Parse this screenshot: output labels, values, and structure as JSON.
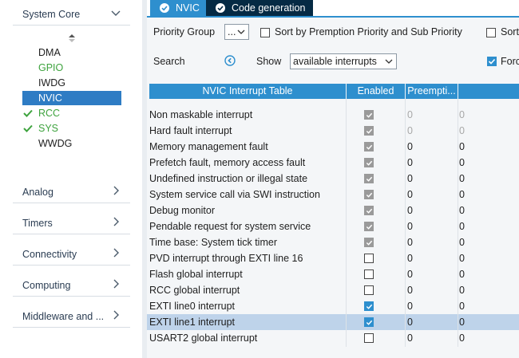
{
  "sidebar": {
    "categories": [
      {
        "label": "System Core",
        "expanded": true
      },
      {
        "label": "Analog"
      },
      {
        "label": "Timers"
      },
      {
        "label": "Connectivity"
      },
      {
        "label": "Computing"
      },
      {
        "label": "Middleware and ..."
      }
    ],
    "peripherals": [
      {
        "label": "DMA",
        "state": "normal"
      },
      {
        "label": "GPIO",
        "state": "green"
      },
      {
        "label": "IWDG",
        "state": "normal"
      },
      {
        "label": "NVIC",
        "state": "selected"
      },
      {
        "label": "RCC",
        "state": "green-checked"
      },
      {
        "label": "SYS",
        "state": "green-checked"
      },
      {
        "label": "WWDG",
        "state": "normal"
      }
    ]
  },
  "tabs": [
    {
      "label": "NVIC",
      "icon": "check-circle-icon"
    },
    {
      "label": "Code generation",
      "icon": "check-circle-icon"
    }
  ],
  "options": {
    "priority_group_label": "Priority Group",
    "priority_group_value": "...",
    "sort_label": "Sort by Premption Priority and Sub Priority",
    "sort_checked": false,
    "sort2_label": "Sort",
    "search_label": "Search",
    "show_label": "Show",
    "show_value": "available interrupts",
    "force_label": "Forc",
    "force_checked": true
  },
  "table": {
    "headers": [
      "NVIC Interrupt Table",
      "Enabled",
      "Preempti...",
      ""
    ],
    "rows": [
      {
        "name": "Non maskable interrupt",
        "enabled": "disabled-checked",
        "preemption": "0",
        "sub": "0",
        "greyed": true,
        "selected": false
      },
      {
        "name": "Hard fault interrupt",
        "enabled": "disabled-checked",
        "preemption": "0",
        "sub": "0",
        "greyed": true,
        "selected": false
      },
      {
        "name": "Memory management fault",
        "enabled": "disabled-checked",
        "preemption": "0",
        "sub": "0",
        "greyed": false,
        "selected": false
      },
      {
        "name": "Prefetch fault, memory access fault",
        "enabled": "disabled-checked",
        "preemption": "0",
        "sub": "0",
        "greyed": false,
        "selected": false
      },
      {
        "name": "Undefined instruction or illegal state",
        "enabled": "disabled-checked",
        "preemption": "0",
        "sub": "0",
        "greyed": false,
        "selected": false
      },
      {
        "name": "System service call via SWI instruction",
        "enabled": "disabled-checked",
        "preemption": "0",
        "sub": "0",
        "greyed": false,
        "selected": false
      },
      {
        "name": "Debug monitor",
        "enabled": "disabled-checked",
        "preemption": "0",
        "sub": "0",
        "greyed": false,
        "selected": false
      },
      {
        "name": "Pendable request for system service",
        "enabled": "disabled-checked",
        "preemption": "0",
        "sub": "0",
        "greyed": false,
        "selected": false
      },
      {
        "name": "Time base: System tick timer",
        "enabled": "disabled-checked",
        "preemption": "0",
        "sub": "0",
        "greyed": false,
        "selected": false
      },
      {
        "name": "PVD interrupt through EXTI line 16",
        "enabled": "unchecked",
        "preemption": "0",
        "sub": "0",
        "greyed": false,
        "selected": false
      },
      {
        "name": "Flash global interrupt",
        "enabled": "unchecked",
        "preemption": "0",
        "sub": "0",
        "greyed": false,
        "selected": false
      },
      {
        "name": "RCC global interrupt",
        "enabled": "unchecked",
        "preemption": "0",
        "sub": "0",
        "greyed": false,
        "selected": false
      },
      {
        "name": "EXTI line0 interrupt",
        "enabled": "checked",
        "preemption": "0",
        "sub": "0",
        "greyed": false,
        "selected": false
      },
      {
        "name": "EXTI line1 interrupt",
        "enabled": "checked",
        "preemption": "0",
        "sub": "0",
        "greyed": false,
        "selected": true
      },
      {
        "name": "USART2 global interrupt",
        "enabled": "unchecked",
        "preemption": "0",
        "sub": "0",
        "greyed": false,
        "selected": false
      }
    ]
  },
  "colors": {
    "accent": "#2e8fce",
    "dark_tab": "#052a44",
    "selected_item": "#2e7cc4",
    "green": "#3ea33e",
    "selected_row": "#bed3ea"
  }
}
